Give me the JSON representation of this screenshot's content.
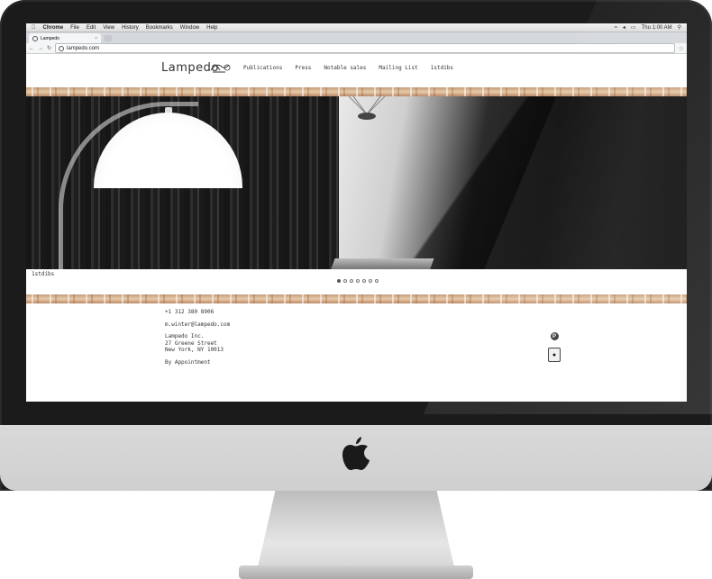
{
  "os_menubar": {
    "app": "Chrome",
    "items": [
      "File",
      "Edit",
      "View",
      "History",
      "Bookmarks",
      "Window",
      "Help"
    ],
    "clock": "Thu 1:00 AM"
  },
  "browser": {
    "tab_title": "Lampedo",
    "url": "lampedo.com"
  },
  "site": {
    "logo": "Lampedo",
    "nav": [
      "Publications",
      "Press",
      "Notable sales",
      "Mailing List",
      "1stdibs"
    ],
    "slide_caption": "1stdibs",
    "slide_dots": 7,
    "active_slide": 1,
    "contact": {
      "phone": "+1 312 380 8906",
      "email": "m.winter@lampedo.com",
      "company": "Lampedo Inc.",
      "street": "27 Greene Street",
      "city": "New York, NY 10013",
      "note": "By Appointment"
    },
    "social_icons": [
      "pinterest-icon",
      "app-icon"
    ]
  },
  "colors": {
    "bezel": "#1b1b1b",
    "chin": "#d9d9d9",
    "border_strip": "#c49c7a"
  }
}
